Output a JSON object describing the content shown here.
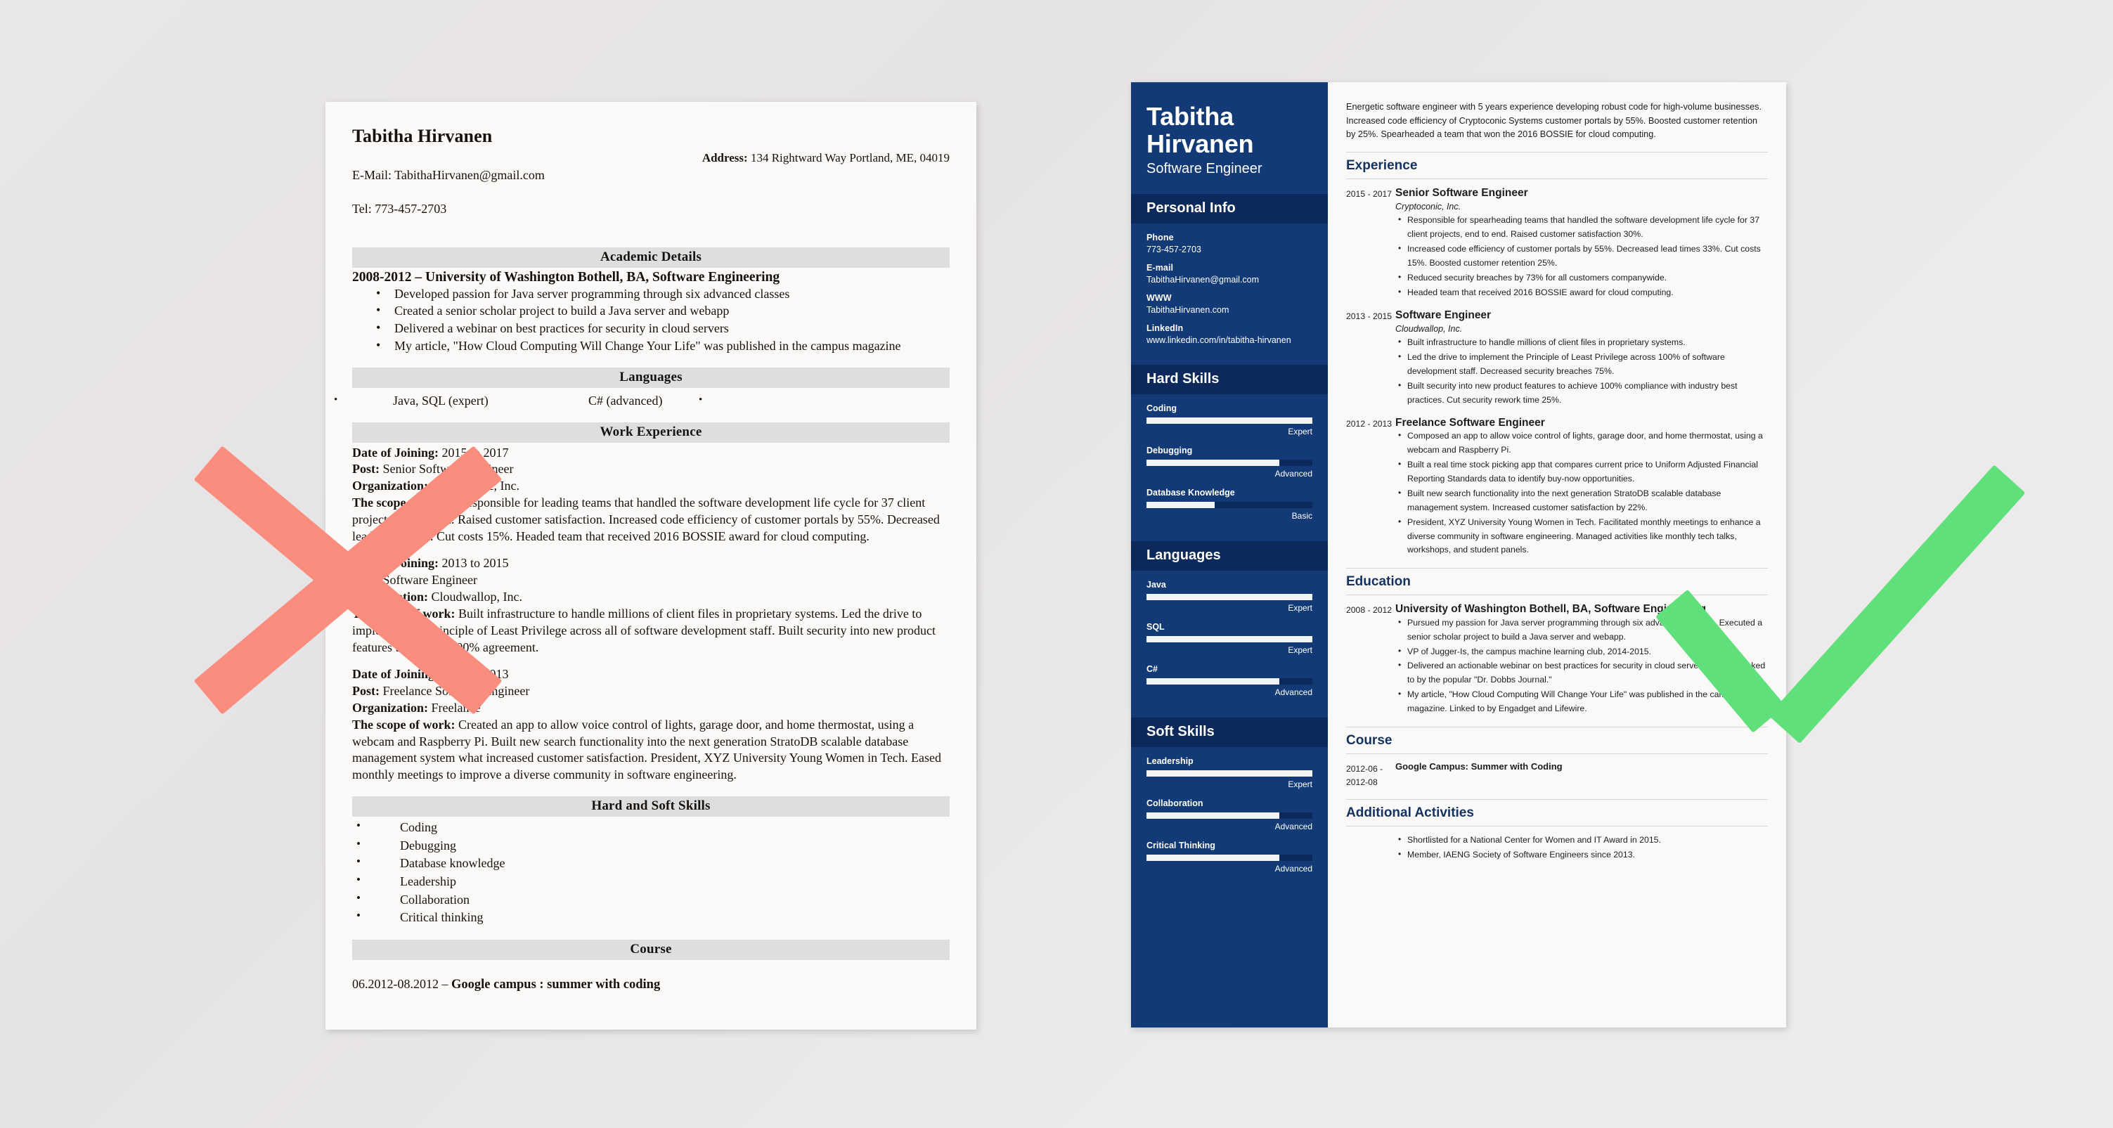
{
  "colors": {
    "sidebar_navy": "#123a77",
    "sidebar_head_navy": "#0b2a5b",
    "heading_navy": "#14315f",
    "band_gray": "#dedede",
    "x_mark_red": "#FA8D7E",
    "check_mark_green": "#5FE07A"
  },
  "bad_resume": {
    "name": "Tabitha Hirvanen",
    "email_line": "E-Mail: TabithaHirvanen@gmail.com",
    "tel_line": "Tel: 773-457-2703",
    "address_label": "Address:",
    "address_value": "134 Rightward Way Portland, ME, 04019",
    "sections": {
      "academic": "Academic Details",
      "languages": "Languages",
      "work": "Work Experience",
      "skills": "Hard and Soft Skills",
      "course": "Course"
    },
    "academic_headline_years": "2008-2012 ",
    "academic_headline_dash": "– ",
    "academic_headline_school": "University of Washington Bothell, BA, Software Engineering",
    "academic_bullets": [
      "Developed passion for Java server programming through six advanced classes",
      "Created a senior scholar project to build a Java server and webapp",
      "Delivered a webinar on best practices for security in cloud servers",
      "My article, \"How Cloud Computing Will Change Your Life\" was published in the campus magazine"
    ],
    "languages": {
      "left": "Java, SQL (expert)",
      "right": "C# (advanced)"
    },
    "jobs": [
      {
        "date_label": "Date of Joining:",
        "date_value": " 2015 to 2017",
        "post_label": "Post:",
        "post_value": " Senior Software Engineer",
        "org_label": "Organization:",
        "org_value": " Cryptoconic, Inc.",
        "scope_label": "The scope of work:",
        "scope_value": " Responsible for leading teams that handled the software development life cycle for 37 client projects, end to end. Raised customer satisfaction. Increased code efficiency of customer portals by 55%. Decreased lead times 33%. Cut costs 15%. Headed team that received 2016 BOSSIE award for cloud computing."
      },
      {
        "date_label": "Date of Joining:",
        "date_value": " 2013 to 2015",
        "post_label": "Post:",
        "post_value": " Software Engineer",
        "org_label": "Organization:",
        "org_value": " Cloudwallop, Inc.",
        "scope_label": "The scope of work:",
        "scope_value": " Built infrastructure to handle millions of client files in proprietary systems. Led the drive to implement the Principle of Least Privilege across all of software development staff. Built security into new product features to achieve 100% agreement."
      },
      {
        "date_label": "Date of Joining:",
        "date_value": " 2012 to 2013",
        "post_label": "Post:",
        "post_value": " Freelance Software Engineer",
        "org_label": "Organization:",
        "org_value": " Freelance",
        "scope_label": "The scope of work:",
        "scope_value": " Created an app to allow voice control of lights, garage door, and home thermostat, using a webcam and Raspberry Pi. Built new search functionality into the next generation StratoDB scalable database management system what increased customer satisfaction. President, XYZ University Young Women in Tech. Eased monthly meetings to improve a diverse community in software engineering."
      }
    ],
    "skills": [
      "Coding",
      "Debugging",
      "Database knowledge",
      "Leadership",
      "Collaboration",
      "Critical thinking"
    ],
    "course_dates": "06.2012-08.2012 – ",
    "course_title": "Google campus : summer with coding"
  },
  "good_resume": {
    "sidebar": {
      "name": "Tabitha Hirvanen",
      "role": "Software Engineer",
      "personal_info_head": "Personal Info",
      "personal_info": [
        {
          "key": "Phone",
          "value": "773-457-2703"
        },
        {
          "key": "E-mail",
          "value": "TabithaHirvanen@gmail.com"
        },
        {
          "key": "WWW",
          "value": "TabithaHirvanen.com"
        },
        {
          "key": "LinkedIn",
          "value": "www.linkedin.com/in/tabitha-hirvanen"
        }
      ],
      "hard_skills_head": "Hard Skills",
      "hard_skills": [
        {
          "name": "Coding",
          "level": "Expert",
          "pct": 100
        },
        {
          "name": "Debugging",
          "level": "Advanced",
          "pct": 80
        },
        {
          "name": "Database Knowledge",
          "level": "Basic",
          "pct": 41
        }
      ],
      "languages_head": "Languages",
      "languages": [
        {
          "name": "Java",
          "level": "Expert",
          "pct": 100
        },
        {
          "name": "SQL",
          "level": "Expert",
          "pct": 100
        },
        {
          "name": "C#",
          "level": "Advanced",
          "pct": 80
        }
      ],
      "soft_skills_head": "Soft Skills",
      "soft_skills": [
        {
          "name": "Leadership",
          "level": "Expert",
          "pct": 100
        },
        {
          "name": "Collaboration",
          "level": "Advanced",
          "pct": 80
        },
        {
          "name": "Critical Thinking",
          "level": "Advanced",
          "pct": 80
        }
      ]
    },
    "main": {
      "summary": "Energetic software engineer with 5 years experience developing robust code for high-volume businesses. Increased code efficiency of Cryptoconic Systems customer portals by 55%. Boosted customer retention by 25%. Spearheaded a team that won the 2016 BOSSIE for cloud computing.",
      "experience_head": "Experience",
      "experience": [
        {
          "dates": "2015 - 2017",
          "title": "Senior Software Engineer",
          "org": "Cryptoconic, Inc.",
          "bullets": [
            "Responsible for spearheading teams that handled the software development life cycle for 37 client projects, end to end. Raised customer satisfaction 30%.",
            "Increased code efficiency of customer portals by 55%. Decreased lead times 33%. Cut costs 15%. Boosted customer retention 25%.",
            "Reduced security breaches by 73% for all customers companywide.",
            "Headed team that received 2016 BOSSIE award for cloud computing."
          ]
        },
        {
          "dates": "2013 - 2015",
          "title": "Software Engineer",
          "org": "Cloudwallop, Inc.",
          "bullets": [
            "Built infrastructure to handle millions of client files in proprietary systems.",
            "Led the drive to implement the Principle of Least Privilege across 100% of software development staff. Decreased security breaches 75%.",
            "Built security into new product features to achieve 100% compliance with industry best practices. Cut security rework time 25%."
          ]
        },
        {
          "dates": "2012 - 2013",
          "title": "Freelance Software Engineer",
          "org": "",
          "bullets": [
            "Composed an app to allow voice control of lights, garage door, and home thermostat, using a webcam and Raspberry Pi.",
            "Built a real time stock picking app that compares current price to Uniform Adjusted Financial Reporting Standards data to identify buy-now opportunities.",
            "Built new search functionality into the next generation StratoDB scalable database management system. Increased customer satisfaction by 22%.",
            "President, XYZ University Young Women in Tech. Facilitated monthly meetings to enhance a diverse community in software engineering. Managed activities like monthly tech talks, workshops, and student panels."
          ]
        }
      ],
      "education_head": "Education",
      "education": [
        {
          "dates": "2008 - 2012",
          "title": "University of Washington Bothell, BA, Software Engineering",
          "org": "",
          "bullets": [
            "Pursued my passion for Java server programming through six advanced classes. Executed a senior scholar project to build a Java server and webapp.",
            "VP of Jugger-Is, the campus machine learning club, 2014-2015.",
            "Delivered an actionable webinar on best practices for security in cloud servers that was linked to by the popular \"Dr. Dobbs Journal.\"",
            "My article, \"How Cloud Computing Will Change Your Life\" was published in the campus magazine. Linked to by Engadget and Lifewire."
          ]
        }
      ],
      "course_head": "Course",
      "course": [
        {
          "dates": "2012-06 - 2012-08",
          "title": "Google Campus: Summer with Coding",
          "org": "",
          "bullets": []
        }
      ],
      "additional_head": "Additional Activities",
      "additional": [
        "Shortlisted for a National Center for Women and IT Award in 2015.",
        "Member, IAENG Society of Software Engineers since 2013."
      ]
    }
  }
}
